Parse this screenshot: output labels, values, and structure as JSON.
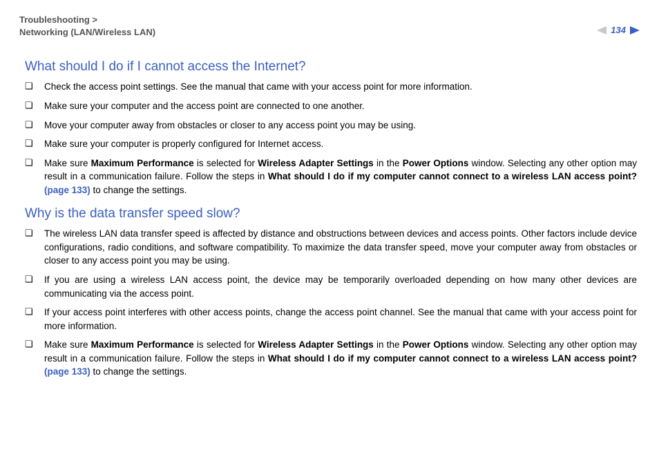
{
  "header": {
    "breadcrumb_line1": "Troubleshooting >",
    "breadcrumb_line2": "Networking (LAN/Wireless LAN)",
    "page_number": "134"
  },
  "section1": {
    "title": "What should I do if I cannot access the Internet?",
    "items": {
      "i0": "Check the access point settings. See the manual that came with your access point for more information.",
      "i1": "Make sure your computer and the access point are connected to one another.",
      "i2": "Move your computer away from obstacles or closer to any access point you may be using.",
      "i3": "Make sure your computer is properly configured for Internet access.",
      "i4": {
        "pre": "Make sure ",
        "b1": "Maximum Performance",
        "mid1": " is selected for ",
        "b2": "Wireless Adapter Settings",
        "mid2": " in the ",
        "b3": "Power Options",
        "mid3": " window. Selecting any other option may result in a communication failure. Follow the steps in ",
        "b4": "What should I do if my computer cannot connect to a wireless LAN access point? ",
        "link": "(page 133)",
        "post": " to change the settings."
      }
    }
  },
  "section2": {
    "title": "Why is the data transfer speed slow?",
    "items": {
      "i0": "The wireless LAN data transfer speed is affected by distance and obstructions between devices and access points. Other factors include device configurations, radio conditions, and software compatibility. To maximize the data transfer speed, move your computer away from obstacles or closer to any access point you may be using.",
      "i1": "If you are using a wireless LAN access point, the device may be temporarily overloaded depending on how many other devices are communicating via the access point.",
      "i2": "If your access point interferes with other access points, change the access point channel. See the manual that came with your access point for more information.",
      "i3": {
        "pre": "Make sure ",
        "b1": "Maximum Performance",
        "mid1": " is selected for ",
        "b2": "Wireless Adapter Settings",
        "mid2": " in the ",
        "b3": "Power Options",
        "mid3": " window. Selecting any other option may result in a communication failure. Follow the steps in ",
        "b4": "What should I do if my computer cannot connect to a wireless LAN access point? ",
        "link": "(page 133)",
        "post": " to change the settings."
      }
    }
  }
}
